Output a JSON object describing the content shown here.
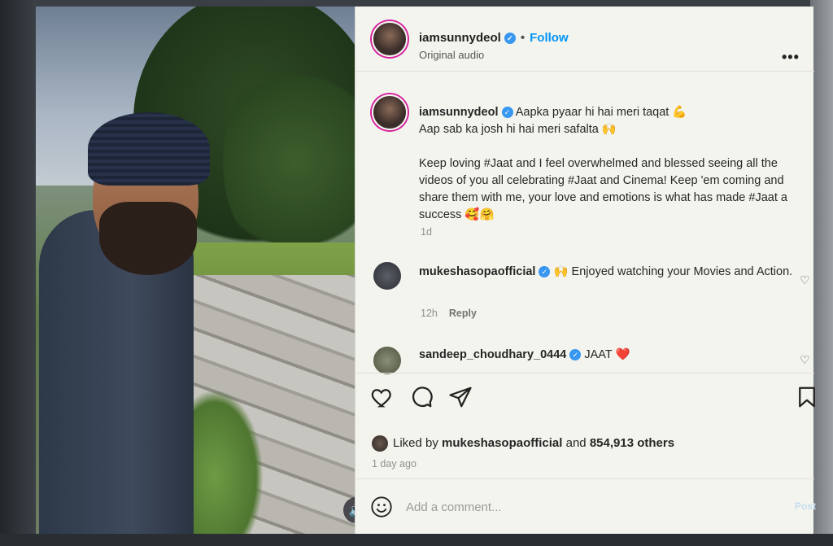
{
  "post": {
    "author": "iamsunnydeol",
    "audio": "Original audio",
    "follow_label": "Follow",
    "separator": "•",
    "more_label": "•••"
  },
  "caption": {
    "author": "iamsunnydeol",
    "line1": "Aapka pyaar hi hai meri taqat 💪",
    "line2": "Aap sab ka josh hi hai meri safalta 🙌",
    "body": "Keep loving #Jaat and I feel overwhelmed and blessed seeing all the videos of you all celebrating #Jaat and Cinema! Keep 'em coming and share them with me, your love and emotions is what has made #Jaat a success 🥰🤗",
    "age": "1d"
  },
  "comments": [
    {
      "user": "mukeshasopaofficial",
      "text": "🙌 Enjoyed watching your Movies and Action.",
      "age": "12h",
      "reply_label": "Reply"
    },
    {
      "user": "sandeep_choudhary_0444",
      "text": "JAAT ❤️"
    }
  ],
  "likes": {
    "prefix": "Liked by",
    "user": "mukeshasopaofficial",
    "and": "and",
    "count": "854,913 others"
  },
  "timestamp": "1 day ago",
  "comment_box": {
    "placeholder": "Add a comment...",
    "post_label": "Post"
  },
  "icons": {
    "verified": "verified-badge-icon",
    "heart": "heart-icon",
    "comment": "comment-icon",
    "share": "share-icon",
    "save": "bookmark-icon",
    "emoji": "emoji-icon",
    "sound": "speaker-icon"
  },
  "colors": {
    "link_blue": "#0095f6",
    "verified_blue": "#3897f0",
    "panel_bg": "#f4f4ee"
  }
}
